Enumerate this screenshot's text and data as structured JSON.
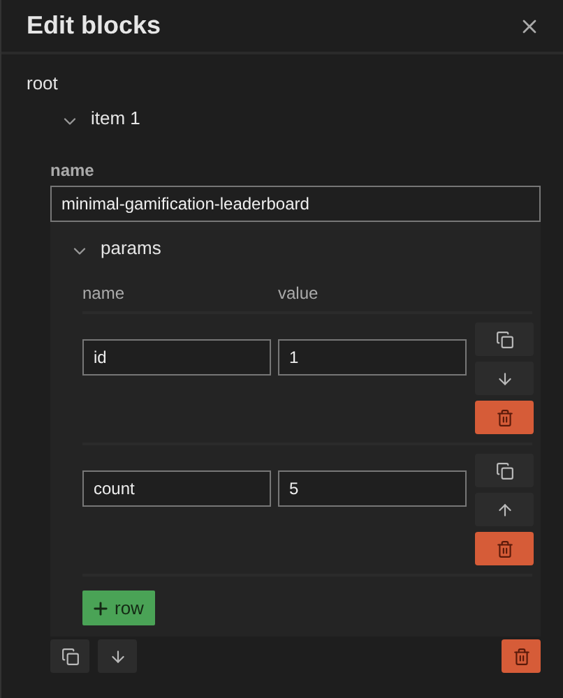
{
  "dialog": {
    "title": "Edit blocks"
  },
  "tree": {
    "label": "root",
    "items": [
      {
        "label": "item 1",
        "expanded": true,
        "name_field": {
          "label": "name",
          "value": "minimal-gamification-leaderboard"
        },
        "params": {
          "label": "params",
          "expanded": true,
          "columns": [
            "name",
            "value"
          ],
          "rows": [
            {
              "name": "id",
              "value": "1",
              "kind": "down"
            },
            {
              "name": "count",
              "value": "5",
              "kind": "up"
            }
          ],
          "add_button": "row"
        },
        "kind": "down"
      }
    ]
  }
}
